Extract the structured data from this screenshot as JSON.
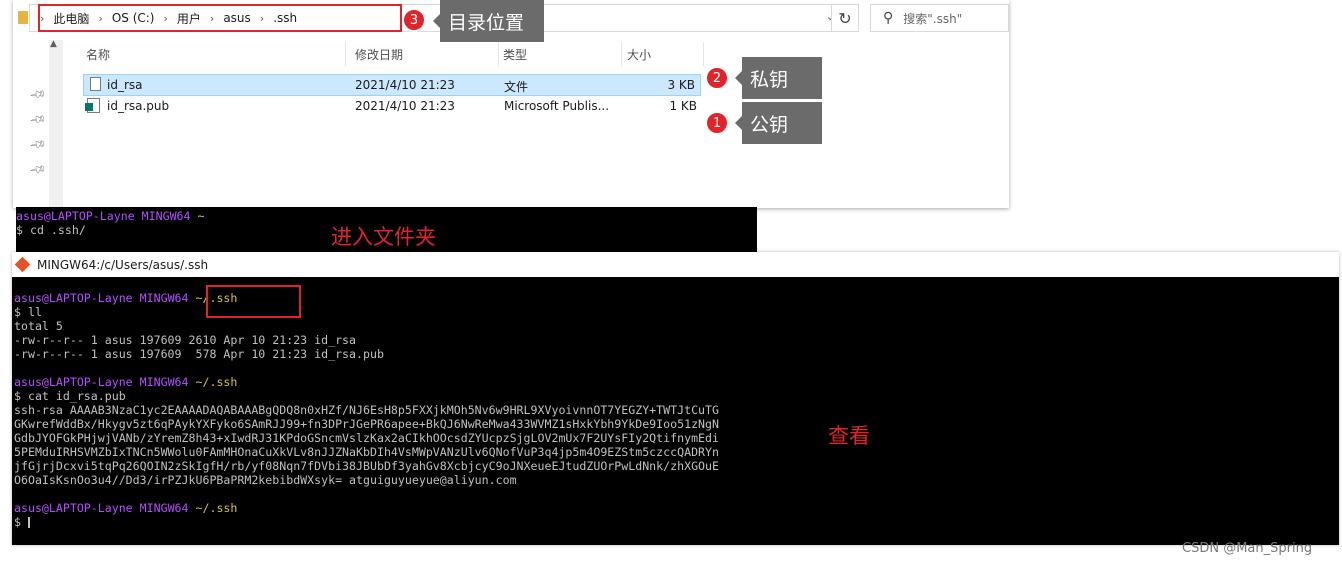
{
  "explorer": {
    "breadcrumb": [
      "此电脑",
      "OS (C:)",
      "用户",
      "asus",
      ".ssh"
    ],
    "search_placeholder": "搜索\".ssh\"",
    "columns": {
      "name": "名称",
      "modified": "修改日期",
      "type": "类型",
      "size": "大小"
    },
    "files": [
      {
        "name": "id_rsa",
        "modified": "2021/4/10 21:23",
        "type": "文件",
        "size": "3 KB",
        "selected": true
      },
      {
        "name": "id_rsa.pub",
        "modified": "2021/4/10 21:23",
        "type": "Microsoft Publis...",
        "size": "1 KB",
        "selected": false
      }
    ]
  },
  "annotations": {
    "num3": "3",
    "label3": "目录位置",
    "num2": "2",
    "label2": "私钥",
    "num1": "1",
    "label1": "公钥",
    "enter_folder": "进入文件夹",
    "view": "查看",
    "accent_color": "#e0242a"
  },
  "terminal1": {
    "prompt_user": "asus@LAPTOP-Layne",
    "prompt_shell": "MINGW64",
    "prompt_path": "~",
    "command": "$ cd .ssh/"
  },
  "terminal2": {
    "title": "MINGW64:/c/Users/asus/.ssh",
    "prompt_user": "asus@LAPTOP-Layne",
    "prompt_shell": "MINGW64",
    "prompt_path": "~/.ssh",
    "cmd1": "$ ll",
    "ll_output": [
      "total 5",
      "-rw-r--r-- 1 asus 197609 2610 Apr 10 21:23 id_rsa",
      "-rw-r--r-- 1 asus 197609  578 Apr 10 21:23 id_rsa.pub"
    ],
    "cmd2": "$ cat id_rsa.pub",
    "key_lines": [
      "ssh-rsa AAAAB3NzaC1yc2EAAAADAQABAAABgQDQ8n0xHZf/NJ6EsH8p5FXXjkMOh5Nv6w9HRL9XVyoivnnOT7YEGZY+TWTJtCuTG",
      "GKwrefWddBx/Hkygv5zt6qPAykYXFyko6SAmRJJ99+fn3DPrJGePR6apee+BkQJ6NwReMwa433WVMZ1sHxkYbh9YkDe9Ioo51zNgN",
      "GdbJYOFGkPHjwjVANb/zYremZ8h43+xIwdRJ31KPdoGSncmVslzKax2aCIkhOOcsdZYUcpzSjgLOV2mUx7F2UYsFIy2QtifnymEdi",
      "5PEMduIRHSVMZbIxTNCn5WWolu0FAmMHOnaCuXkVLv8nJJZNaKbDIh4VsMWpVANzUlv6QNofVuP3q4jp5m4O9EZStm5czccQADRYn",
      "jfGjrjDcxvi5tqPq26QOIN2zSkIgfH/rb/yf08Nqn7fDVbi38JBUbDf3yahGv8XcbjcyC9oJNXeueEJtudZUOrPwLdNnk/zhXGOuE",
      "O6OaIsKsnOo3u4//Dd3/irPZJkU6PBaPRM2kebibdWXsyk= atguiguyueyue@aliyun.com"
    ],
    "final_prompt": "$"
  },
  "watermark": "CSDN @Man_Spring"
}
